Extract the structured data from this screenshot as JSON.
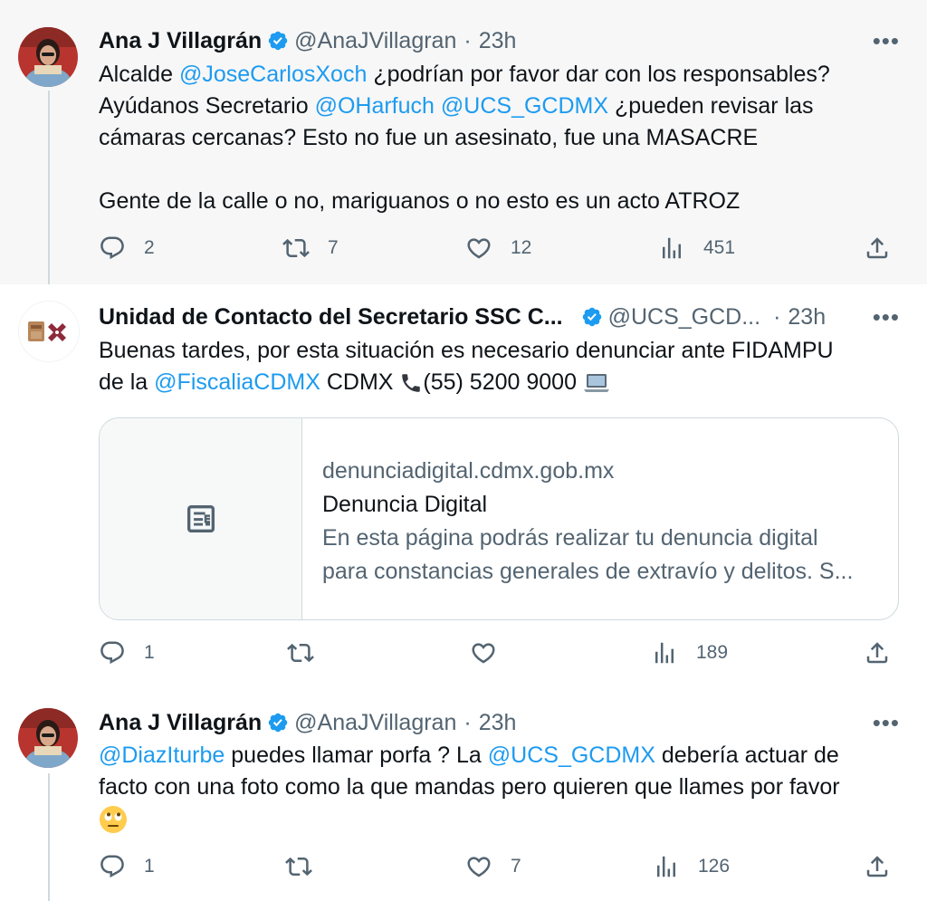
{
  "tweets": [
    {
      "name": "Ana J Villagrán",
      "handle": "@AnaJVillagran",
      "dot": "·",
      "time": "23h",
      "more": "•••",
      "body": {
        "l1_a": "Alcalde ",
        "l1_m": "@JoseCarlosXoch",
        "l1_b": " ¿podrían por favor dar con los responsables?",
        "l2_a": "Ayúdanos Secretario ",
        "l2_m1": "@OHarfuch",
        "l2_sp": " ",
        "l2_m2": "@UCS_GCDMX",
        "l2_b": " ¿pueden revisar las",
        "l3": "cámaras cercanas? Esto no fue un asesinato, fue una MASACRE",
        "l5": "Gente de la calle o no, mariguanos o no esto es un acto ATROZ"
      },
      "stats": {
        "replies": "2",
        "retweets": "7",
        "likes": "12",
        "views": "451"
      }
    },
    {
      "name": "Unidad de Contacto del Secretario SSC C...",
      "handle": "@UCS_GCD...",
      "dot": "·",
      "time": "23h",
      "more": "•••",
      "body": {
        "l1": "Buenas tardes, por esta situación es necesario denunciar ante FIDAMPU",
        "l2_a": "de la ",
        "l2_m": "@FiscaliaCDMX",
        "l2_b": " CDMX ",
        "l2_phone": "(55) 5200 9000"
      },
      "card": {
        "domain": "denunciadigital.cdmx.gob.mx",
        "title": "Denuncia Digital",
        "desc1": "En esta página podrás realizar tu denuncia digital",
        "desc2": "para constancias generales de extravío y delitos. S..."
      },
      "stats": {
        "replies": "1",
        "retweets": "",
        "likes": "",
        "views": "189"
      }
    },
    {
      "name": "Ana J Villagrán",
      "handle": "@AnaJVillagran",
      "dot": "·",
      "time": "23h",
      "more": "•••",
      "body": {
        "l1_m1": "@DiazIturbe",
        "l1_a": " puedes llamar porfa ? La ",
        "l1_m2": "@UCS_GCDMX",
        "l1_b": " debería actuar de",
        "l2": "facto con una foto como la que mandas pero quieren que llames por favor"
      },
      "stats": {
        "replies": "1",
        "retweets": "",
        "likes": "7",
        "views": "126"
      }
    }
  ],
  "colors": {
    "accent": "#1d9bf0",
    "muted": "#536471",
    "text": "#0f1419",
    "highlight_bg": "#f7f7f7"
  }
}
